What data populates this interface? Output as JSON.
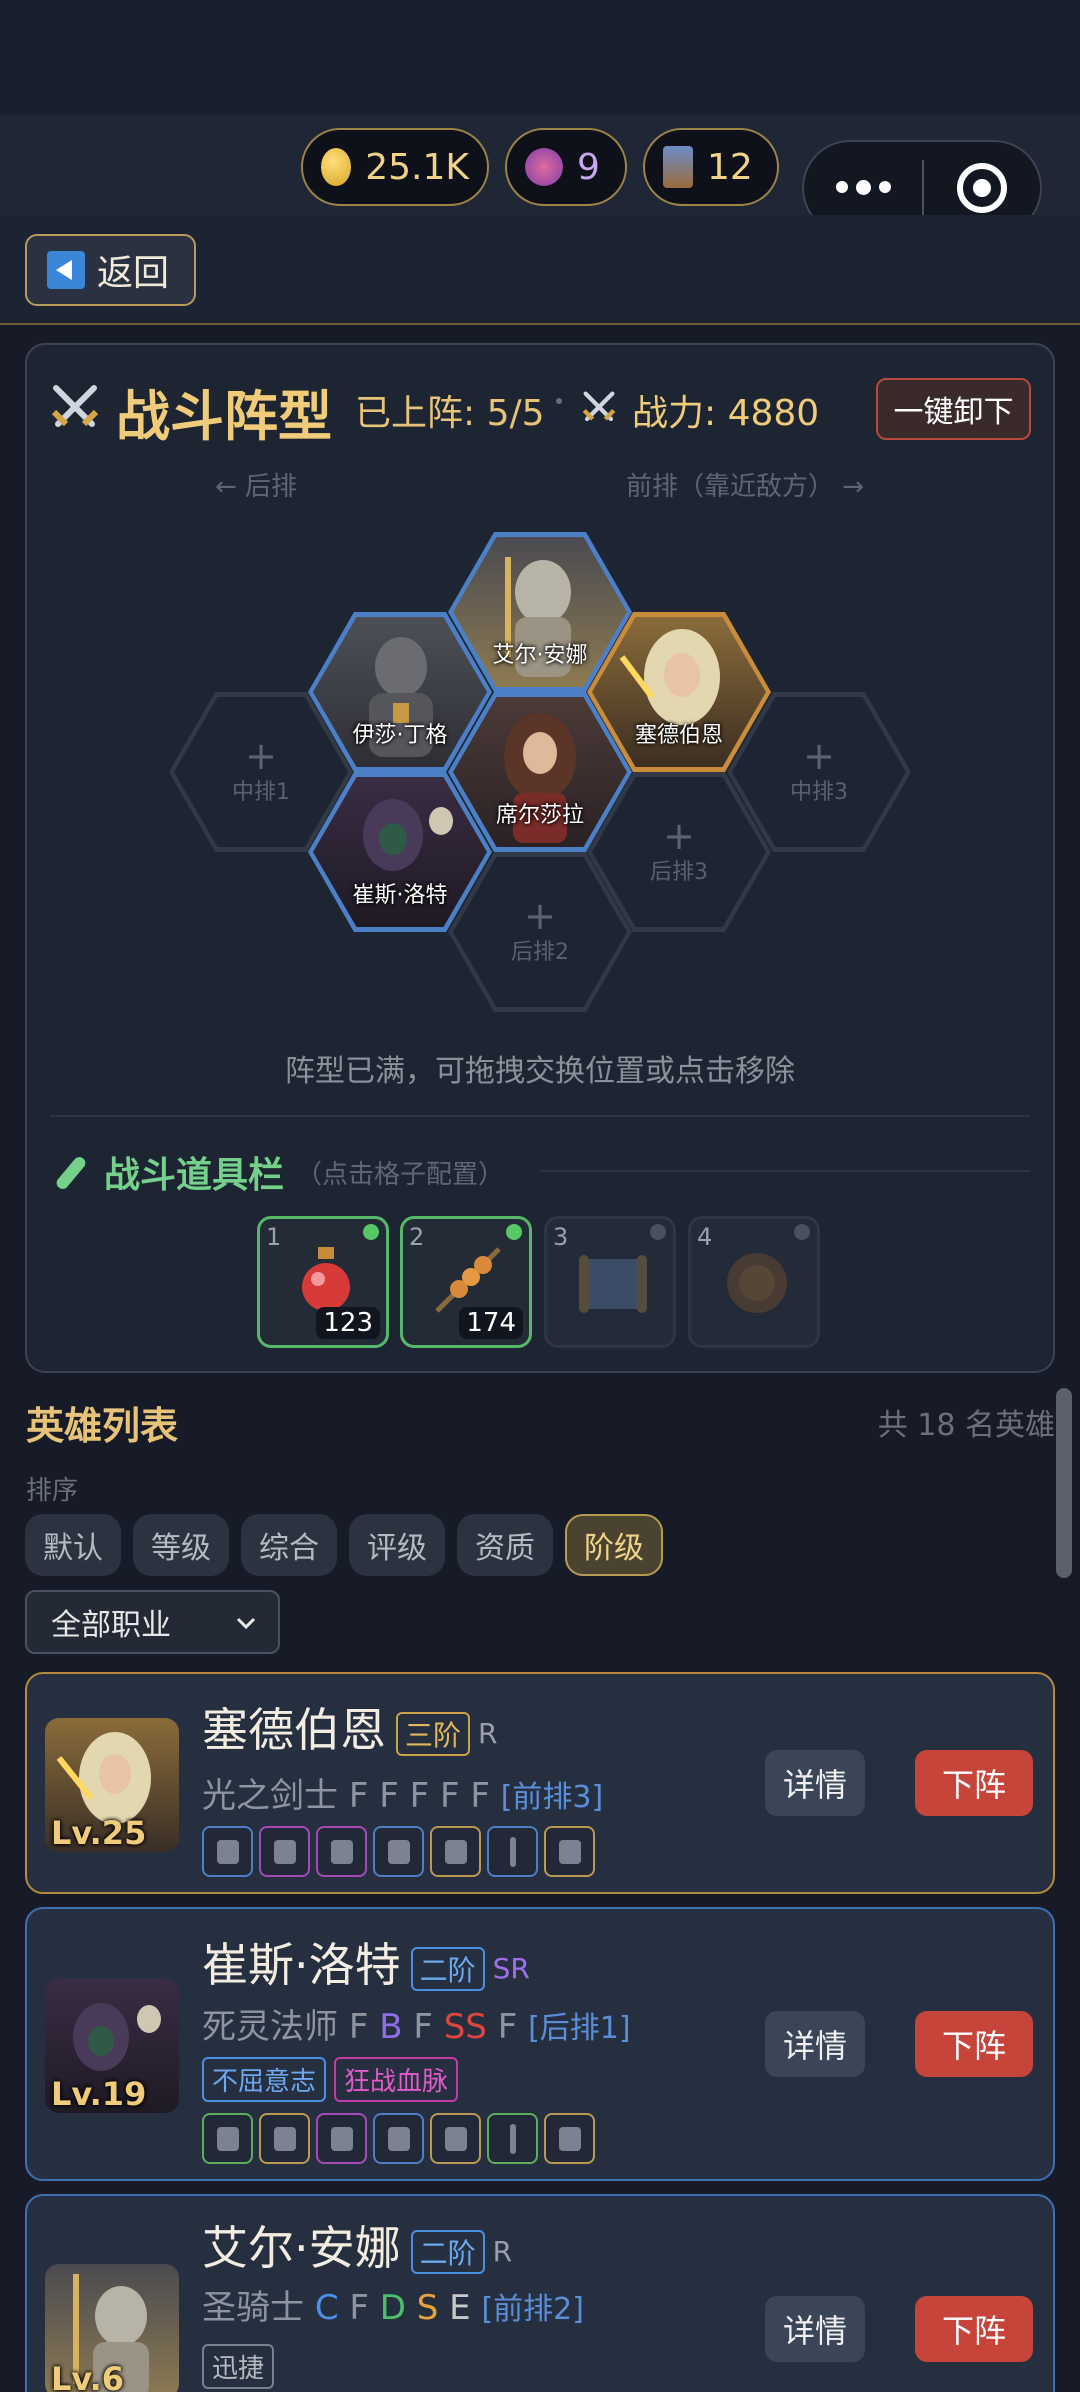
{
  "topbar": {
    "gold": "25.1K",
    "gem": "9",
    "card": "12"
  },
  "back": {
    "label": "返回"
  },
  "formation": {
    "title": "战斗阵型",
    "deployed": "已上阵: 5/5",
    "power": "战力: 4880",
    "unload_all": "一键卸下",
    "back_row": "← 后排",
    "front_row": "前排（靠近敌方） →",
    "slots": [
      {
        "label": "中排1"
      },
      {
        "label": "中排3"
      },
      {
        "label": "后排3"
      },
      {
        "label": "后排2"
      }
    ],
    "heroes": [
      "艾尔·安娜",
      "伊莎·丁格",
      "塞德伯恩",
      "席尔莎拉",
      "崔斯·洛特"
    ],
    "hint": "阵型已满，可拖拽交换位置或点击移除"
  },
  "items": {
    "title": "战斗道具栏",
    "subtitle": "（点击格子配置）",
    "slots": [
      {
        "num": "1",
        "count": "123"
      },
      {
        "num": "2",
        "count": "174"
      },
      {
        "num": "3",
        "count": ""
      },
      {
        "num": "4",
        "count": ""
      }
    ]
  },
  "herolist": {
    "title": "英雄列表",
    "total": "共 18 名英雄",
    "sort_label": "排序",
    "sorts": [
      "默认",
      "等级",
      "综合",
      "评级",
      "资质",
      "阶级"
    ],
    "filter": "全部职业",
    "detail": "详情",
    "remove": "下阵"
  },
  "cards": [
    {
      "name": "塞德伯恩",
      "tier": "三阶",
      "rarity": "R",
      "level": "Lv.25",
      "cls": "光之剑士",
      "grades": [
        "F",
        "F",
        "F",
        "F",
        "F"
      ],
      "pos": "[前排3]",
      "traits": []
    },
    {
      "name": "崔斯·洛特",
      "tier": "二阶",
      "rarity": "SR",
      "level": "Lv.19",
      "cls": "死灵法师",
      "grades": [
        "F",
        "B",
        "F",
        "SS",
        "F"
      ],
      "pos": "[后排1]",
      "traits": [
        "不屈意志",
        "狂战血脉"
      ]
    },
    {
      "name": "艾尔·安娜",
      "tier": "二阶",
      "rarity": "R",
      "level": "Lv.6",
      "cls": "圣骑士",
      "grades": [
        "C",
        "F",
        "D",
        "S",
        "E"
      ],
      "pos": "[前排2]",
      "traits": [
        "迅捷"
      ]
    }
  ],
  "colors": {
    "accent_gold": "#f0cc7a",
    "remove_red": "#c7443a",
    "ss": "#e0453e",
    "b": "#8f6ee8",
    "s": "#e9a23c",
    "d": "#4cbf6a",
    "c": "#4c90e8",
    "e": "#c9c9c9"
  }
}
